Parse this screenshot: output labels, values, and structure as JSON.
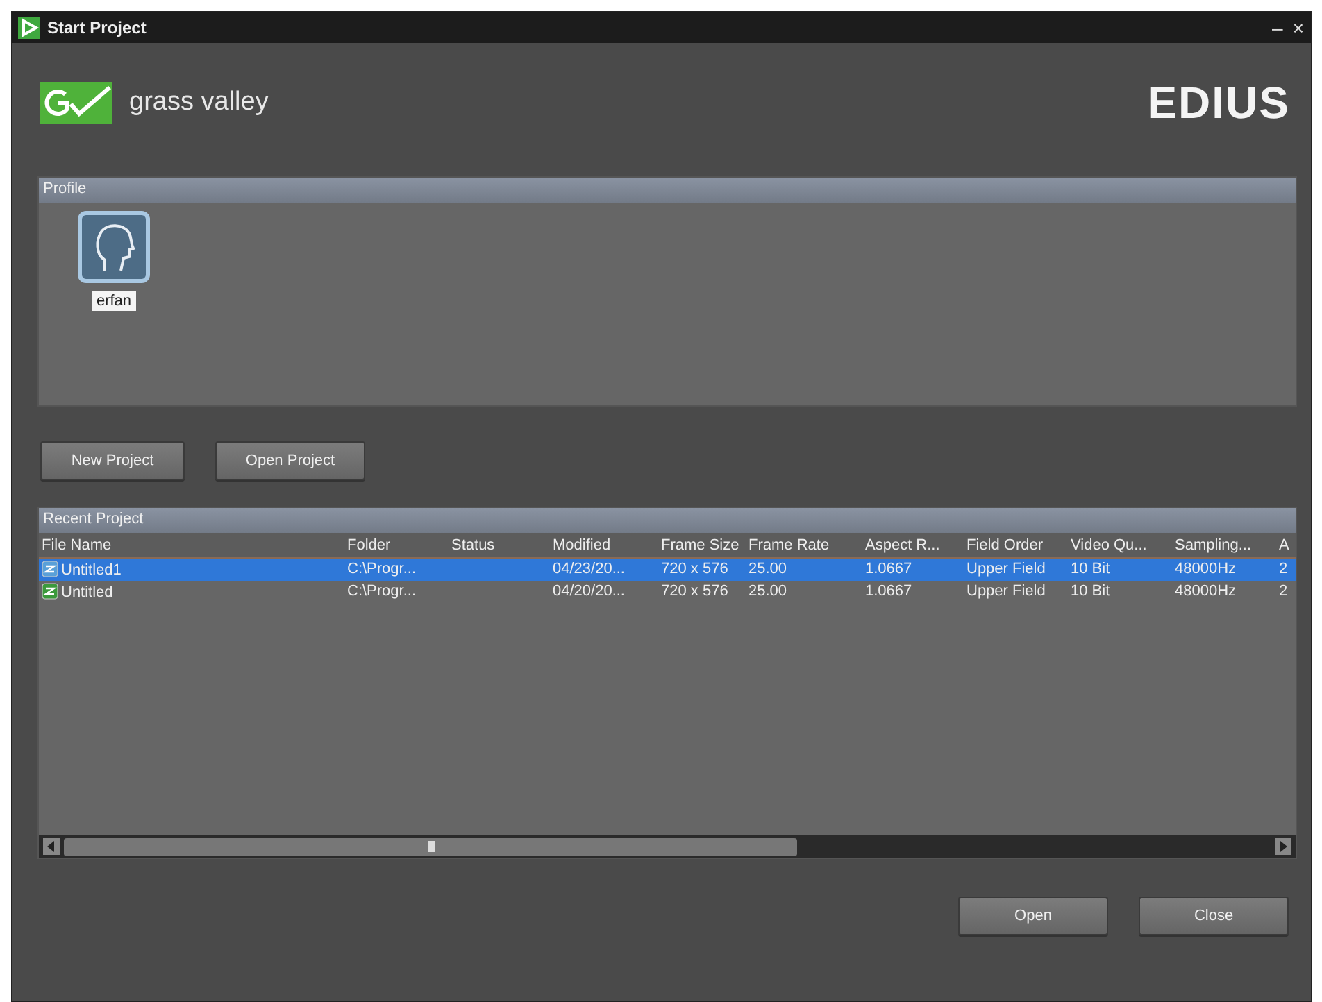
{
  "window": {
    "title": "Start Project",
    "controls": [
      "–",
      "×"
    ]
  },
  "brand": {
    "company": "grass valley",
    "product": "EDIUS"
  },
  "profile": {
    "heading": "Profile",
    "users": [
      {
        "name": "erfan",
        "selected": true
      }
    ]
  },
  "actions": [
    "New Project",
    "Open Project"
  ],
  "recent": {
    "heading": "Recent Project",
    "columns": [
      "File Name",
      "Folder",
      "Status",
      "Modified",
      "Frame Size",
      "Frame Rate",
      "Aspect R...",
      "Field Order",
      "Video Qu...",
      "Sampling...",
      "A"
    ],
    "rows": [
      {
        "selected": true,
        "cells": [
          "Untitled1",
          "C:\\Progr...",
          "",
          "04/23/20...",
          "720 x  576",
          "25.00",
          "1.0667",
          "Upper Field",
          "10 Bit",
          "48000Hz",
          "2"
        ]
      },
      {
        "selected": false,
        "cells": [
          "Untitled",
          "C:\\Progr...",
          "",
          "04/20/20...",
          "720 x  576",
          "25.00",
          "1.0667",
          "Upper Field",
          "10 Bit",
          "48000Hz",
          "2"
        ]
      }
    ]
  },
  "footer_buttons": [
    "Open",
    "Close"
  ]
}
